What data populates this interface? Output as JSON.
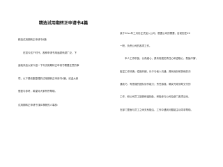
{
  "document": {
    "title": "精选试用期转正申请书4篇",
    "left_column": {
      "lines": [
        "精选试用期转正申请书4篇",
        "　　在如今这个时代，各种申请书用途越来越广泛，下",
        "面就来给大家介绍一下写试用期转正申请书需要注意的事",
        "项，以下是收集整理的试用期转正申请书4篇，欢迎大家",
        "借鉴与参考，希望对大家有所帮助。",
        "试用期转正申请书 篇1尊敬的人事部："
      ]
    },
    "right_column": {
      "lines": [
        "我于20xx年三月份正式加入公司，根据公司的需要，目前担任XX",
        "一职，负责公司的各项工作。",
        "　　本人工作积极，认真细心，具有较强的责任心和进取心，勤勉不懈，",
        "极富工作热情；性格开朗，乐于与他人沟通，具有良好和熟练的沟",
        "通技巧，有很强的团队协作能力；责任感强，确实完成领导交付的",
        "工作，和公司员工能够和谐相处，积极参与公司及部门各项活动，",
        "在部门里面与员工之间关系融洽，工作中遇到问题能主动寻求帮助。"
      ]
    }
  }
}
